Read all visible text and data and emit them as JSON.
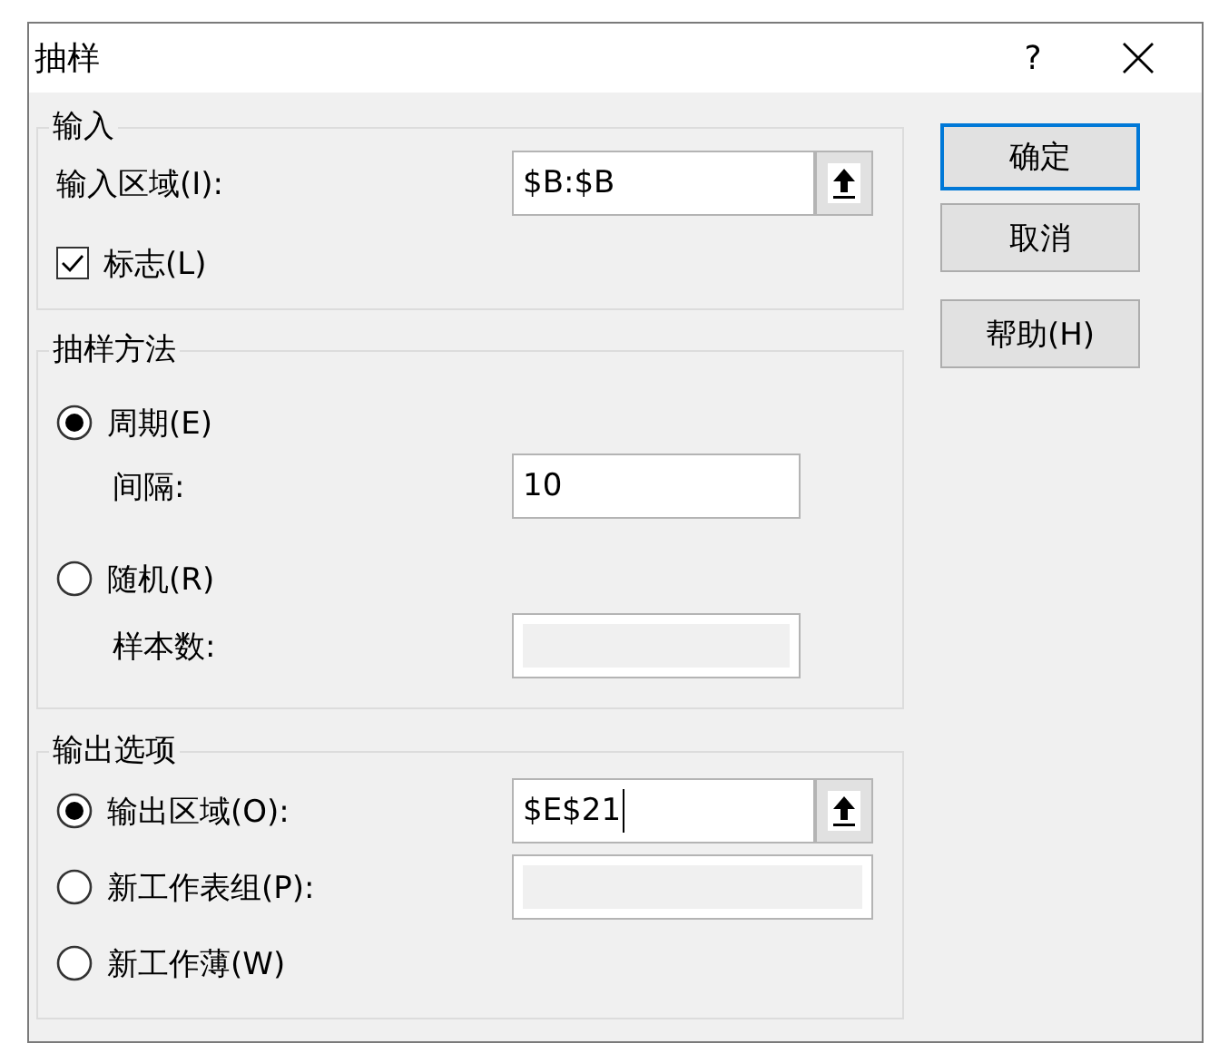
{
  "window": {
    "title": "抽样",
    "help": "?"
  },
  "input_group": {
    "title": "输入",
    "range_label": "输入区域(I):",
    "range_value": "$B:$B",
    "labels_checkbox": {
      "label": "标志(L)",
      "checked": true
    }
  },
  "sampling_group": {
    "title": "抽样方法",
    "options": [
      {
        "label": "周期(E)",
        "selected": true,
        "field_label": "间隔:",
        "value": "10",
        "disabled": false
      },
      {
        "label": "随机(R)",
        "selected": false,
        "field_label": "样本数:",
        "disabled": true
      }
    ]
  },
  "output_group": {
    "title": "输出选项",
    "options": [
      {
        "kind": "field",
        "label": "输出区域(O):",
        "selected": true,
        "value": "$E$21",
        "disabled": false,
        "focused": true
      },
      {
        "kind": "field",
        "label": "新工作表组(P):",
        "selected": false,
        "disabled": true
      },
      {
        "kind": "plain",
        "label": "新工作薄(W)",
        "selected": false
      }
    ]
  },
  "buttons": [
    {
      "label": "确定",
      "default": true
    },
    {
      "label": "取消",
      "default": false
    },
    {
      "label": "帮助(H)",
      "default": false
    }
  ]
}
